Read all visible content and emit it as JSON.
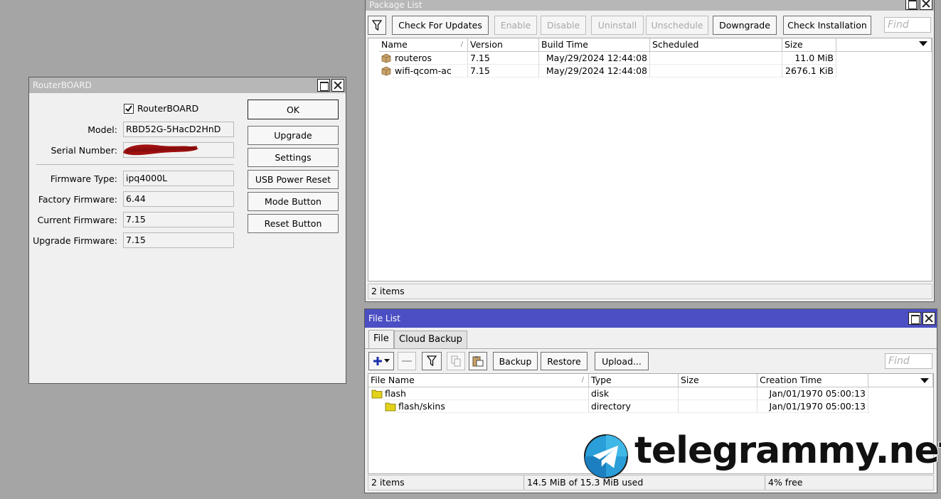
{
  "routerboard": {
    "title": "RouterBOARD",
    "checkbox_label": "RouterBOARD",
    "fields": [
      {
        "label": "Model:",
        "value": "RBD52G-5HacD2HnD"
      },
      {
        "label": "Serial Number:",
        "value": ""
      },
      {
        "label": "Firmware Type:",
        "value": "ipq4000L"
      },
      {
        "label": "Factory Firmware:",
        "value": "6.44"
      },
      {
        "label": "Current Firmware:",
        "value": "7.15"
      },
      {
        "label": "Upgrade Firmware:",
        "value": "7.15"
      }
    ],
    "buttons": [
      "OK",
      "Upgrade",
      "Settings",
      "USB Power Reset",
      "Mode Button",
      "Reset Button"
    ]
  },
  "package_list": {
    "title": "Package List",
    "toolbar": [
      "Check For Updates",
      "Enable",
      "Disable",
      "Uninstall",
      "Unschedule",
      "Downgrade",
      "Check Installation"
    ],
    "find_placeholder": "Find",
    "columns": [
      "Name",
      "Version",
      "Build Time",
      "Scheduled",
      "Size"
    ],
    "rows": [
      {
        "name": "routeros",
        "version": "7.15",
        "build_time": "May/29/2024 12:44:08",
        "scheduled": "",
        "size": "11.0 MiB"
      },
      {
        "name": "wifi-qcom-ac",
        "version": "7.15",
        "build_time": "May/29/2024 12:44:08",
        "scheduled": "",
        "size": "2676.1 KiB"
      }
    ],
    "status": "2 items"
  },
  "file_list": {
    "title": "File List",
    "tabs": [
      "File",
      "Cloud Backup"
    ],
    "toolbar": [
      "Backup",
      "Restore",
      "Upload..."
    ],
    "find_placeholder": "Find",
    "columns": [
      "File Name",
      "Type",
      "Size",
      "Creation Time"
    ],
    "rows": [
      {
        "name": "flash",
        "type": "disk",
        "size": "",
        "created": "Jan/01/1970 05:00:13"
      },
      {
        "name": "flash/skins",
        "type": "directory",
        "size": "",
        "created": "Jan/01/1970 05:00:13"
      }
    ],
    "status_items": "2 items",
    "status_used": "14.5 MiB of 15.3 MiB used",
    "status_free": "4% free"
  },
  "watermark": {
    "text": "telegrammy.net"
  },
  "colors": {
    "title_active": "#4b4fc3",
    "title_inactive": "#b7b7b7",
    "desktop": "#a5a5a5",
    "redaction": "#a01010"
  }
}
